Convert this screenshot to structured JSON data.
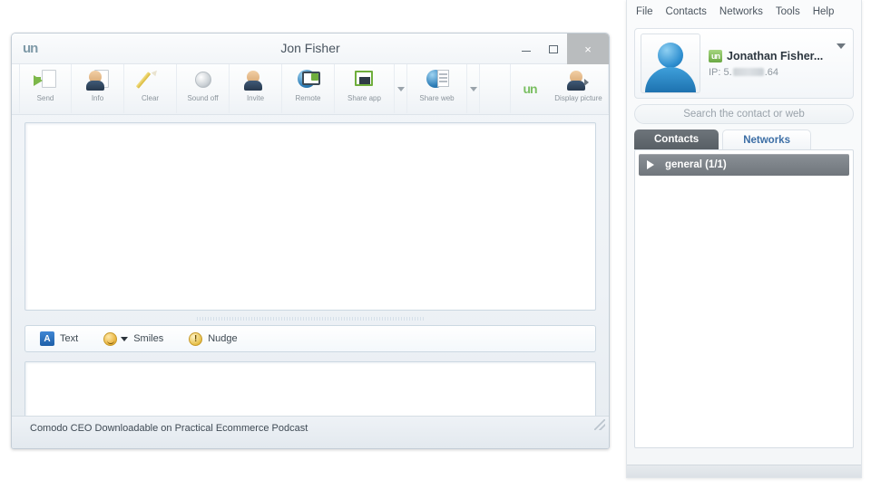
{
  "chat_window": {
    "title": "Jon Fisher",
    "logo": "un",
    "window_controls": {
      "minimize": "minimize-icon",
      "maximize": "maximize-icon",
      "close": "×"
    },
    "ribbon": {
      "items": [
        {
          "label": "Send",
          "icon": "send-mail-icon"
        },
        {
          "label": "Info",
          "icon": "contact-info-icon"
        },
        {
          "label": "Clear",
          "icon": "pencil-clear-icon"
        },
        {
          "label": "Sound off",
          "icon": "sound-off-icon"
        },
        {
          "label": "Invite",
          "icon": "invite-people-icon"
        },
        {
          "label": "Remote",
          "icon": "remote-desktop-icon"
        },
        {
          "label": "Share app",
          "icon": "share-app-icon"
        },
        {
          "label": "Share web",
          "icon": "share-web-icon"
        }
      ],
      "logo": "un",
      "display_picture_label": "Display picture",
      "display_picture_icon": "display-picture-icon"
    },
    "format_bar": {
      "text_label": "Text",
      "text_icon": "A",
      "smiles_label": "Smiles",
      "smiles_icon": "smiley-icon",
      "nudge_label": "Nudge",
      "nudge_icon": "!"
    },
    "transcript": {
      "messages": []
    },
    "compose": {
      "value": "",
      "placeholder": ""
    },
    "send_button": "Send",
    "search_icon": "magnifier-icon",
    "status_text": "Comodo CEO Downloadable on Practical Ecommerce Podcast"
  },
  "contacts_panel": {
    "menu": [
      "File",
      "Contacts",
      "Networks",
      "Tools",
      "Help"
    ],
    "profile": {
      "name": "Jonathan  Fisher...",
      "badge": "un",
      "ip_prefix": "IP: 5.",
      "ip_suffix": ".64",
      "avatar": "default-avatar-icon",
      "dropdown_icon": "chevron-down-icon"
    },
    "search": {
      "placeholder": "Search the contact or web",
      "value": ""
    },
    "tabs": [
      {
        "label": "Contacts",
        "active": true
      },
      {
        "label": "Networks",
        "active": false
      }
    ],
    "groups": [
      {
        "label": "general (1/1)",
        "expanded": false,
        "toggle_icon": "triangle-right-icon"
      }
    ]
  },
  "colors": {
    "accent_green": "#6aa843",
    "accent_blue": "#2e8fd0",
    "tab_active_bg": "#585f65",
    "group_row_bg": "#70767c",
    "logo_gray_blue": "#7f9aa8"
  }
}
